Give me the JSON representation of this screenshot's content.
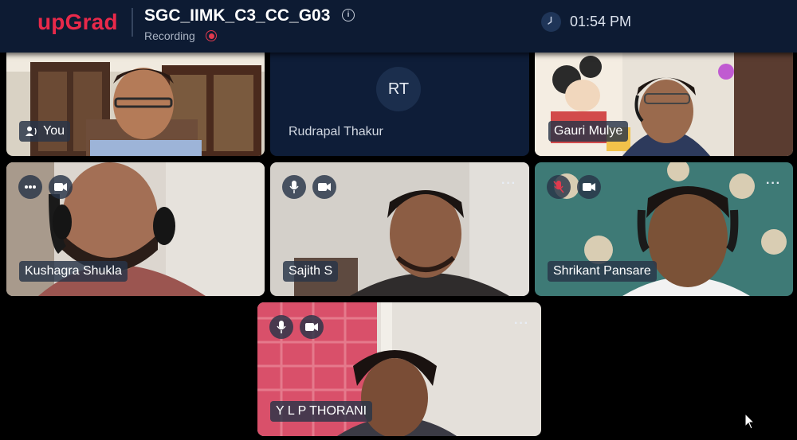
{
  "app": {
    "logo": "upGrad",
    "meeting_title": "SGC_IIMK_C3_CC_G03",
    "recording_label": "Recording",
    "time": "01:54 PM"
  },
  "participants": [
    {
      "name": "You"
    },
    {
      "name": "Rudrapal Thakur",
      "initials": "RT"
    },
    {
      "name": "Gauri Mulye"
    },
    {
      "name": "Kushagra Shukla"
    },
    {
      "name": "Sajith S"
    },
    {
      "name": "Shrikant Pansare"
    },
    {
      "name": "Y L P THORANI"
    }
  ],
  "more_label": "···",
  "colors": {
    "topbar": "#0d1b33",
    "brand": "#e8294a",
    "empty_tile": "#0e1d38",
    "mic_muted": "#e03a4e"
  }
}
